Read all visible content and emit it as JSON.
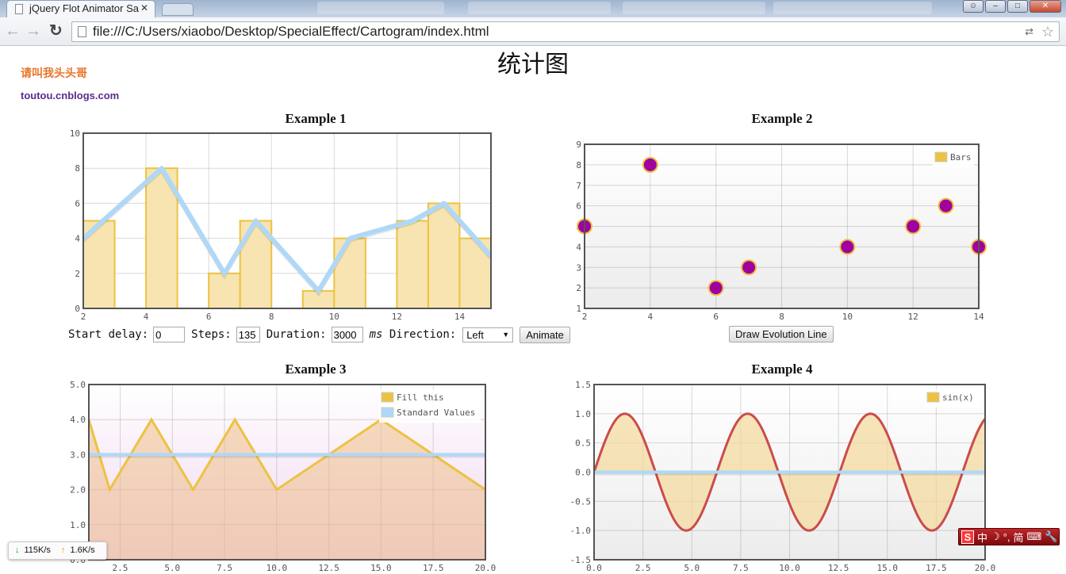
{
  "browser": {
    "tab_title": "jQuery Flot Animator Sa",
    "url": "file:///C:/Users/xiaobo/Desktop/SpecialEffect/Cartogram/index.html"
  },
  "page": {
    "title": "统计图",
    "nickname": "请叫我头头哥",
    "blog": "toutou.cnblogs.com"
  },
  "example1": {
    "title": "Example 1",
    "controls": {
      "start_delay_label": "Start delay:",
      "start_delay": "0",
      "steps_label": "Steps:",
      "steps": "135",
      "duration_label": "Duration:",
      "duration": "3000",
      "ms_label": "ms",
      "direction_label": "Direction:",
      "direction": "Left",
      "animate_label": "Animate"
    }
  },
  "example2": {
    "title": "Example 2",
    "button_label": "Draw Evolution Line"
  },
  "example3": {
    "title": "Example 3"
  },
  "example4": {
    "title": "Example 4"
  },
  "status": {
    "download": "115K/s",
    "upload": "1.6K/s"
  },
  "ime": {
    "logo": "S",
    "mode": "中",
    "moon": "☽",
    "punct": "°,",
    "script": "简"
  },
  "chart_data": [
    {
      "type": "bar+line",
      "xlim": [
        2,
        15
      ],
      "ylim": [
        0,
        10
      ],
      "xticks": [
        2,
        4,
        6,
        8,
        10,
        12,
        14
      ],
      "yticks": [
        0,
        2,
        4,
        6,
        8,
        10
      ],
      "grid": true,
      "series": [
        {
          "type": "bar",
          "bar_width": 1,
          "color": "#edc240",
          "points": [
            [
              2,
              5
            ],
            [
              4,
              8
            ],
            [
              6,
              2
            ],
            [
              7,
              5
            ],
            [
              9,
              1
            ],
            [
              10,
              4
            ],
            [
              12,
              5
            ],
            [
              13,
              6
            ],
            [
              14,
              4
            ]
          ]
        },
        {
          "type": "line",
          "color": "#afd8f8",
          "points": [
            [
              2,
              4
            ],
            [
              4.5,
              8
            ],
            [
              6.5,
              2
            ],
            [
              7.5,
              5
            ],
            [
              9.5,
              1
            ],
            [
              10.5,
              4
            ],
            [
              12.5,
              5
            ],
            [
              13.5,
              6
            ],
            [
              15,
              3
            ]
          ]
        }
      ]
    },
    {
      "type": "scatter",
      "xlim": [
        2,
        14
      ],
      "ylim": [
        1,
        9
      ],
      "xticks": [
        2,
        4,
        6,
        8,
        10,
        12,
        14
      ],
      "yticks": [
        1,
        2,
        3,
        4,
        5,
        6,
        7,
        8,
        9
      ],
      "grid": true,
      "legend": "top-right",
      "series": [
        {
          "name": "Bars",
          "type": "points",
          "color": "#edc240",
          "point_fill": "#a000a0",
          "points": [
            [
              2,
              5
            ],
            [
              4,
              8
            ],
            [
              6,
              2
            ],
            [
              7,
              3
            ],
            [
              10,
              4
            ],
            [
              12,
              5
            ],
            [
              13,
              6
            ],
            [
              14,
              4
            ]
          ]
        }
      ]
    },
    {
      "type": "area",
      "xlim": [
        1,
        20
      ],
      "ylim": [
        0,
        5
      ],
      "xticks": [
        2.5,
        5,
        7.5,
        10,
        12.5,
        15,
        17.5,
        20
      ],
      "yticks": [
        0,
        1,
        2,
        3,
        4,
        5
      ],
      "tick_decimals": 1,
      "grid": true,
      "legend": "top-right",
      "series": [
        {
          "name": "Fill this",
          "type": "area",
          "color": "#edc240",
          "points": [
            [
              1,
              4
            ],
            [
              2,
              2
            ],
            [
              4,
              4
            ],
            [
              6,
              2
            ],
            [
              8,
              4
            ],
            [
              10,
              2
            ],
            [
              15,
              4
            ],
            [
              20,
              2
            ]
          ]
        },
        {
          "name": "Standard Values",
          "type": "line",
          "color": "#afd8f8",
          "points": [
            [
              1,
              3
            ],
            [
              20,
              3
            ]
          ]
        }
      ]
    },
    {
      "type": "area",
      "xlim": [
        0,
        20
      ],
      "ylim": [
        -1.5,
        1.5
      ],
      "xticks": [
        0,
        2.5,
        5,
        7.5,
        10,
        12.5,
        15,
        17.5,
        20
      ],
      "yticks": [
        -1.5,
        -1,
        -0.5,
        0,
        0.5,
        1,
        1.5
      ],
      "tick_decimals": 1,
      "grid": true,
      "legend": "top-right",
      "series": [
        {
          "name": "sin(x)",
          "type": "area",
          "function": "sin(x)",
          "color": "#edc240",
          "line_color": "#cb4b4b"
        },
        {
          "type": "line",
          "color": "#afd8f8",
          "points": [
            [
              0,
              0
            ],
            [
              20,
              0
            ]
          ]
        }
      ]
    }
  ]
}
